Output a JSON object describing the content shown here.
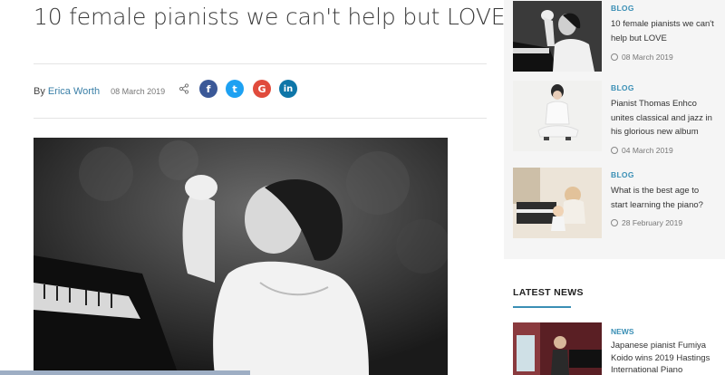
{
  "article": {
    "title": "10 female pianists we can't help but LOVE",
    "by_label": "By",
    "author": "Erica Worth",
    "date": "08 March 2019",
    "social": {
      "facebook": "f",
      "twitter": "t",
      "google": "G",
      "linkedin": "in"
    }
  },
  "sidebar": {
    "posts": [
      {
        "category": "BLOG",
        "title": "10 female pianists we can't help but LOVE",
        "date": "08 March 2019"
      },
      {
        "category": "BLOG",
        "title": "Pianist Thomas Enhco unites classical and jazz in his glorious new album",
        "date": "04 March 2019"
      },
      {
        "category": "BLOG",
        "title": "What is the best age to start learning the piano?",
        "date": "28 February 2019"
      }
    ],
    "latest_news": {
      "heading": "LATEST NEWS",
      "item": {
        "category": "NEWS",
        "title": "Japanese pianist Fumiya Koido wins 2019 Hastings International Piano"
      }
    }
  },
  "colors": {
    "accent": "#3a8fb5",
    "facebook": "#3b5998",
    "twitter": "#1da1f2",
    "google": "#e04b3c",
    "linkedin": "#0e76a8"
  }
}
